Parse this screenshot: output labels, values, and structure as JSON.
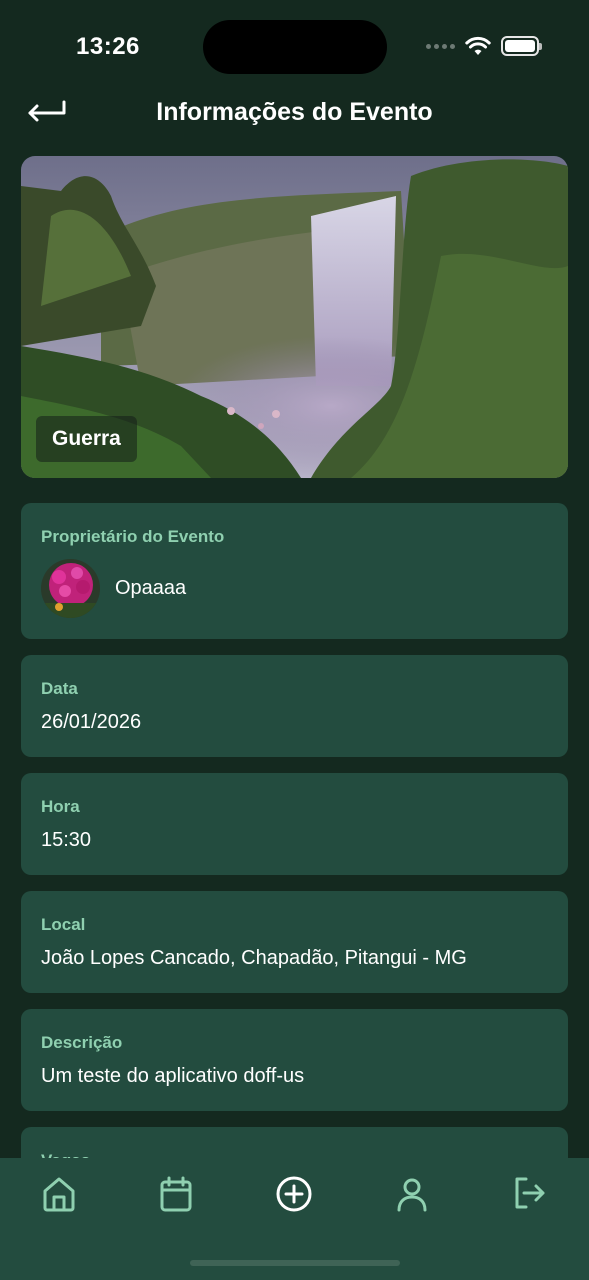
{
  "status": {
    "time": "13:26"
  },
  "header": {
    "title": "Informações do Evento"
  },
  "hero": {
    "event_name": "Guerra"
  },
  "owner": {
    "label": "Proprietário do Evento",
    "name": "Opaaaa"
  },
  "date": {
    "label": "Data",
    "value": "26/01/2026"
  },
  "time": {
    "label": "Hora",
    "value": "15:30"
  },
  "location": {
    "label": "Local",
    "value": "João Lopes Cancado, Chapadão, Pitangui - MG"
  },
  "description": {
    "label": "Descrição",
    "value": "Um teste do aplicativo doff-us"
  },
  "vacancies": {
    "label": "Vagas"
  },
  "tabbar": {
    "items": [
      "home-icon",
      "calendar-icon",
      "add-circle-icon",
      "user-icon",
      "logout-icon"
    ],
    "accent": "#8fd0b0",
    "active": "#ffffff"
  },
  "colors": {
    "background": "#14291f",
    "card": "#234c3f",
    "label": "#8fd0b0"
  }
}
